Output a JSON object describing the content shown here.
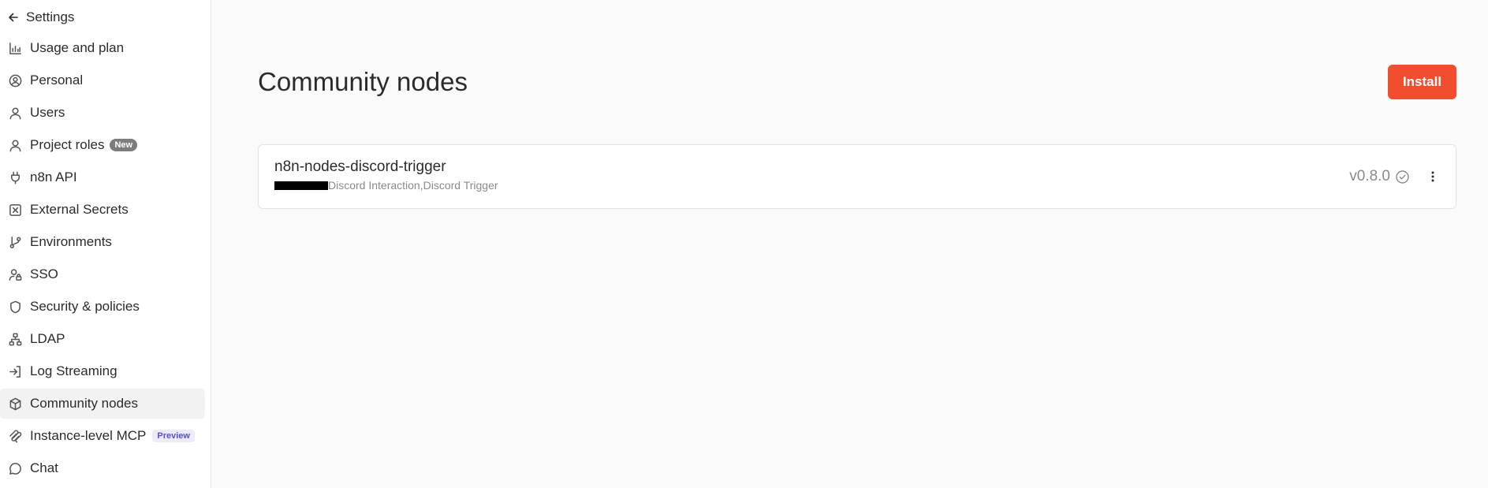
{
  "sidebar": {
    "back_label": "Settings",
    "items": [
      {
        "label": "Usage and plan",
        "icon": "bar-chart-icon"
      },
      {
        "label": "Personal",
        "icon": "user-circle-icon"
      },
      {
        "label": "Users",
        "icon": "user-icon"
      },
      {
        "label": "Project roles",
        "icon": "user-icon",
        "badge": "New"
      },
      {
        "label": "n8n API",
        "icon": "plug-icon"
      },
      {
        "label": "External Secrets",
        "icon": "vault-icon"
      },
      {
        "label": "Environments",
        "icon": "git-branch-icon"
      },
      {
        "label": "SSO",
        "icon": "user-lock-icon"
      },
      {
        "label": "Security & policies",
        "icon": "shield-icon"
      },
      {
        "label": "LDAP",
        "icon": "network-icon"
      },
      {
        "label": "Log Streaming",
        "icon": "sign-in-icon"
      },
      {
        "label": "Community nodes",
        "icon": "box-icon",
        "active": true
      },
      {
        "label": "Instance-level MCP",
        "icon": "mcp-icon",
        "badge": "Preview"
      },
      {
        "label": "Chat",
        "icon": "chat-bubble-icon"
      }
    ]
  },
  "main": {
    "title": "Community nodes",
    "install_label": "Install",
    "packages": [
      {
        "name": "n8n-nodes-discord-trigger",
        "nodes": "Discord Interaction,Discord Trigger",
        "version": "v0.8.0"
      }
    ]
  },
  "colors": {
    "accent": "#f04e2f",
    "preview_badge": "#5a4fcf",
    "new_badge": "#7d7d7d"
  }
}
